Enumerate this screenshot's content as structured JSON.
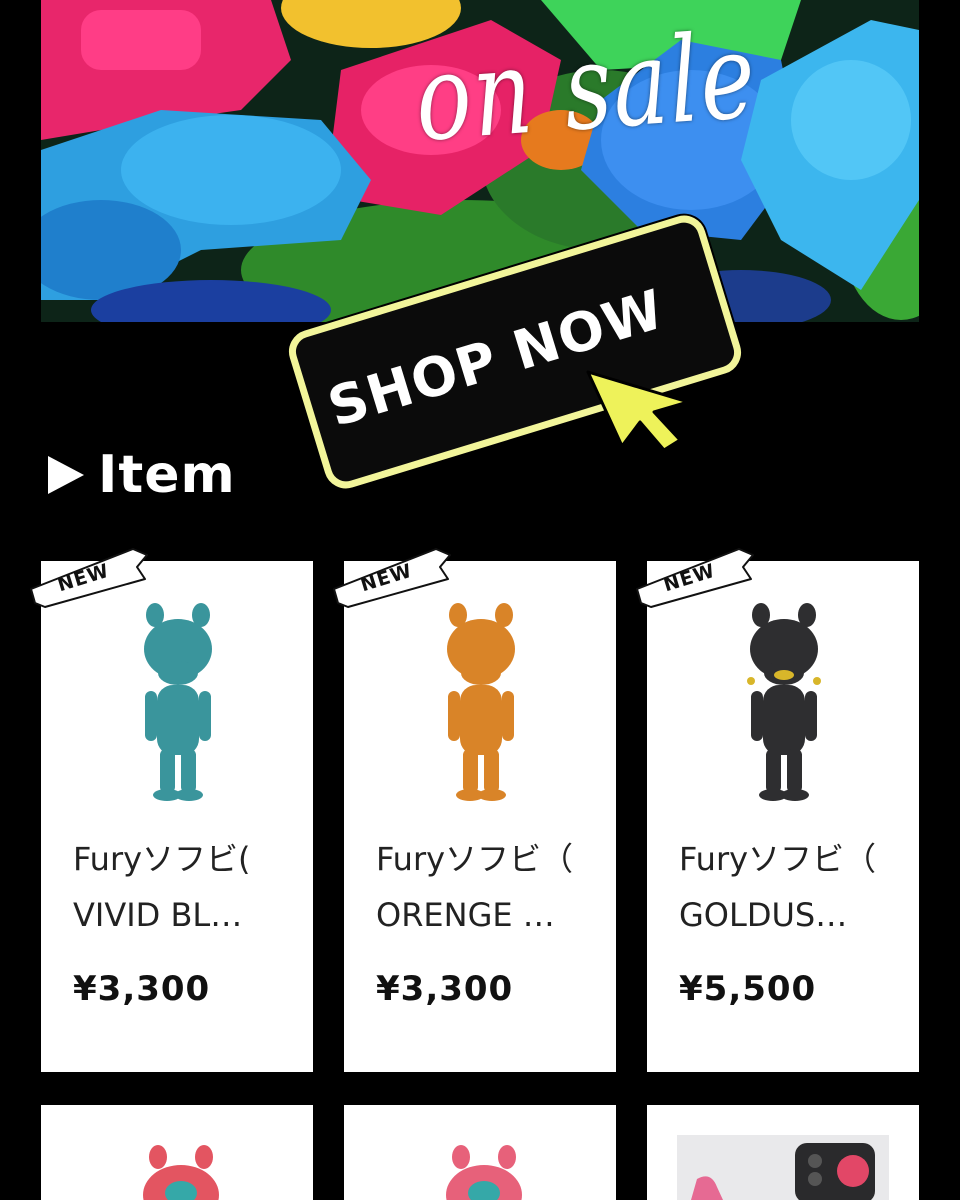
{
  "banner": {
    "text": "on sale",
    "button_label": "SHOP NOW"
  },
  "section": {
    "title": "Item"
  },
  "products": [
    {
      "badge": "NEW",
      "name_line1": "Furyソフビ(",
      "name_line2": "VIVID BL…",
      "price": "¥3,300",
      "color": "#3a959c"
    },
    {
      "badge": "NEW",
      "name_line1": "Furyソフビ（",
      "name_line2": "ORENGE …",
      "price": "¥3,300",
      "color": "#d98428"
    },
    {
      "badge": "NEW",
      "name_line1": "Furyソフビ（",
      "name_line2": "GOLDUS…",
      "price": "¥5,500",
      "color": "#2e2e30"
    }
  ],
  "colors": {
    "background": "#000000",
    "card": "#ffffff",
    "button_border": "#f2f59a",
    "cursor": "#eef25a"
  }
}
